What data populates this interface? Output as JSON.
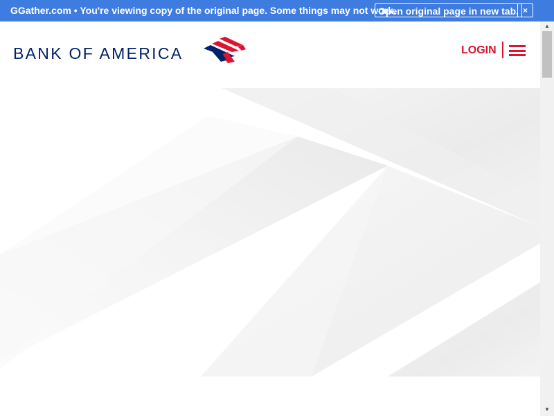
{
  "notice_bar": {
    "text": "GGather.com • You're viewing copy of the original page. Some things may not work.",
    "open_button_label": "Open original page in new tab.",
    "close_label": "×"
  },
  "header": {
    "logo_text": "BANK OF AMERICA",
    "logo_icon": "flag-logo-icon",
    "login_label": "LOGIN",
    "menu_icon": "hamburger-menu-icon"
  },
  "scrollbar": {
    "up_arrow": "▲",
    "down_arrow": "▼"
  },
  "colors": {
    "notice_background": "#3f7ce0",
    "brand_navy": "#012169",
    "brand_red": "#dc1431",
    "hero_gray": "#f0f0f0"
  }
}
